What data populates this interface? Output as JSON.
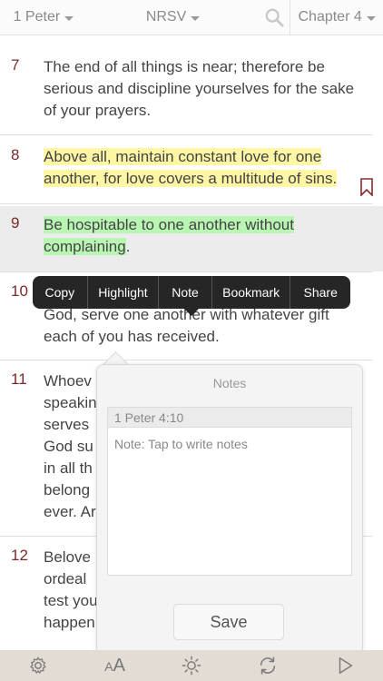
{
  "topbar": {
    "book": "1 Peter",
    "translation": "NRSV",
    "chapter": "Chapter 4"
  },
  "verses": [
    {
      "num": "7",
      "text": "The end of all things is near; therefore be serious and discipline yourselves for the sake of your prayers."
    },
    {
      "num": "8",
      "text": "Above all, maintain constant love for one another, for love covers a multitude of sins."
    },
    {
      "num": "9",
      "text_highlighted": "Be hospitable to one another without complaining",
      "text_tail": "."
    },
    {
      "num": "10",
      "text": "Like good stewards of the manifold grace of God, serve one another with whatever gift each of you has received."
    },
    {
      "num": "11",
      "lines": [
        "Whoev",
        "speakin",
        "serves",
        "God su",
        "in all th",
        "belong",
        "ever. Ar"
      ]
    },
    {
      "num": "12",
      "lines": [
        "Belove",
        "ordeal",
        "test you",
        "happen"
      ]
    }
  ],
  "context_menu": {
    "items": [
      "Copy",
      "Highlight",
      "Note",
      "Bookmark",
      "Share"
    ]
  },
  "notes": {
    "title": "Notes",
    "reference": "1 Peter  4:10",
    "placeholder": "Note: Tap to write notes",
    "save_label": "Save"
  },
  "colors": {
    "verse_number": "#7a2a2a",
    "highlight_yellow": "#fdf6a5",
    "highlight_green": "#b9f5b3",
    "bottom_bar": "#e3dcd5",
    "context_menu": "#262626"
  },
  "icons": {
    "search": "search-icon",
    "bookmark": "bookmark-icon",
    "settings": "gear-icon",
    "font_size": "font-size-icon",
    "brightness": "brightness-icon",
    "sync": "sync-icon",
    "play": "play-icon"
  },
  "bottombar": {
    "font_size_label_big": "A",
    "font_size_label_small": "A"
  }
}
